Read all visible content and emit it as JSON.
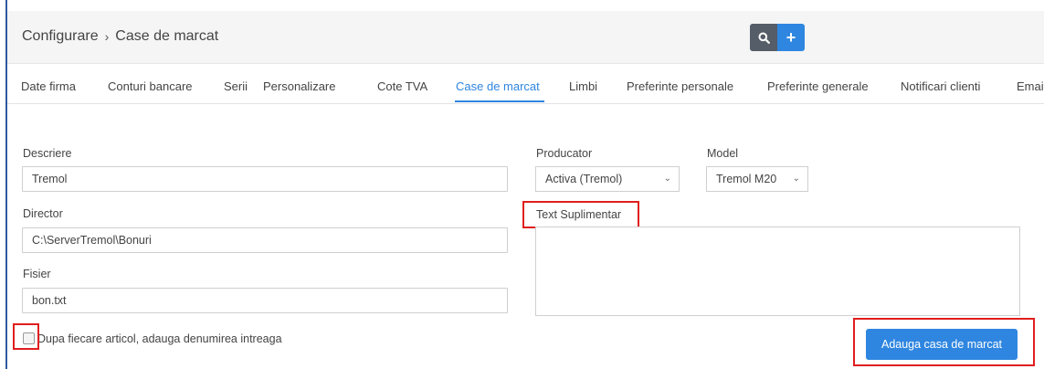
{
  "header": {
    "breadcrumb_root": "Configurare",
    "breadcrumb_separator": "›",
    "breadcrumb_current": "Case de marcat",
    "search_icon": "search-icon",
    "add_icon": "plus-icon",
    "add_label": "+"
  },
  "tabs": [
    {
      "label": "Date firma"
    },
    {
      "label": "Conturi bancare"
    },
    {
      "label": "Serii"
    },
    {
      "label": "Personalizare"
    },
    {
      "label": "Cote TVA"
    },
    {
      "label": "Case de marcat",
      "active": true
    },
    {
      "label": "Limbi"
    },
    {
      "label": "Preferinte personale"
    },
    {
      "label": "Preferinte generale"
    },
    {
      "label": "Notificari clienti"
    },
    {
      "label": "Emai"
    }
  ],
  "form": {
    "descriere_label": "Descriere",
    "descriere_value": "Tremol",
    "director_label": "Director",
    "director_value": "C:\\ServerTremol\\Bonuri",
    "fisier_label": "Fisier",
    "fisier_value": "bon.txt",
    "producator_label": "Producator",
    "producator_value": "Activa (Tremol)",
    "model_label": "Model",
    "model_value": "Tremol M20",
    "text_suplimentar_label": "Text Suplimentar",
    "text_suplimentar_value": "",
    "checkbox_label": "Dupa fiecare articol, adauga denumirea intreaga",
    "checkbox_checked": false,
    "submit_label": "Adauga casa de marcat"
  },
  "colors": {
    "accent": "#2f86e0",
    "highlight": "#e01e1e",
    "search_button": "#555d68"
  }
}
